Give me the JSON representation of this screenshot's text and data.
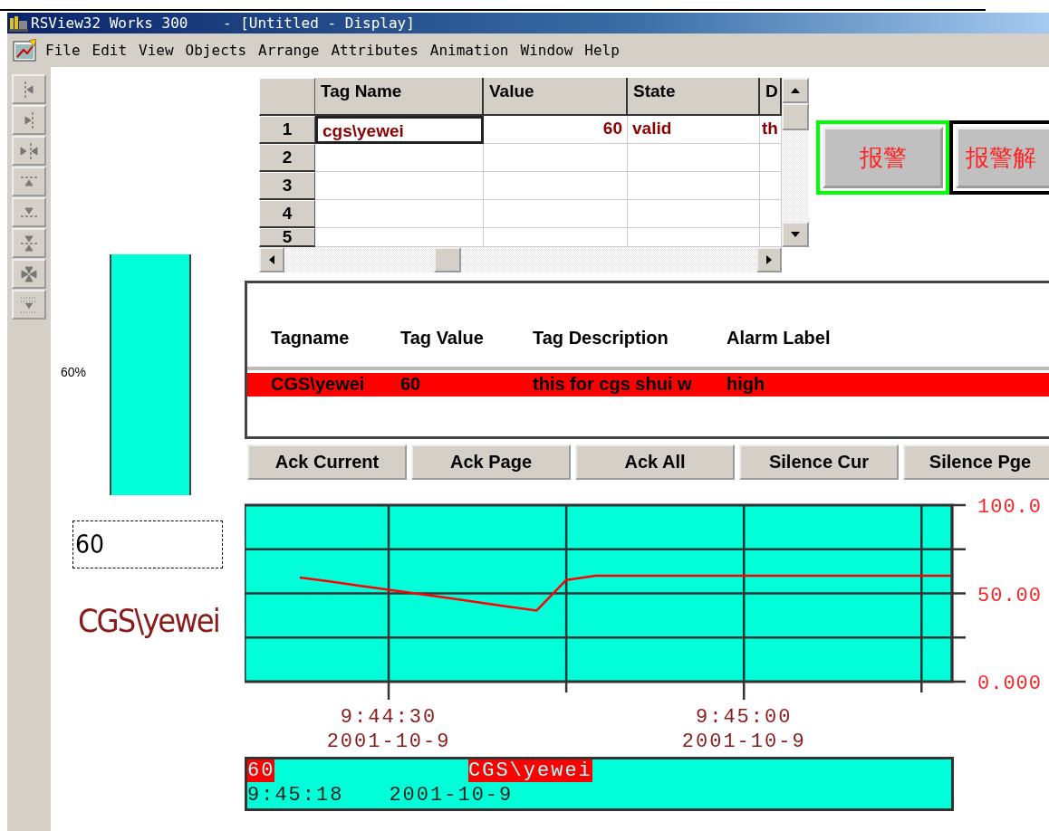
{
  "window": {
    "title": "RSView32 Works 300    - [Untitled - Display]"
  },
  "menu": [
    "File",
    "Edit",
    "View",
    "Objects",
    "Arrange",
    "Attributes",
    "Animation",
    "Window",
    "Help"
  ],
  "bar_graph": {
    "label": "60%"
  },
  "numeric_display": {
    "value": "60"
  },
  "tag_label": {
    "text": "CGS\\yewei"
  },
  "tag_table": {
    "columns": [
      "Tag Name",
      "Value",
      "State",
      "D"
    ],
    "rows": [
      {
        "number": "1",
        "selected": true,
        "cells": [
          "cgs\\yewei",
          "60",
          "valid",
          "th"
        ]
      },
      {
        "number": "2",
        "selected": false
      },
      {
        "number": "3",
        "selected": false
      },
      {
        "number": "4",
        "selected": false
      },
      {
        "number": "5",
        "selected": false
      }
    ]
  },
  "alarm_buttons": [
    {
      "label": "报警",
      "color": "#00ff00"
    },
    {
      "label": "报警解",
      "color": "#000000"
    }
  ],
  "alarm_summary": {
    "columns": [
      "Tagname",
      "Tag Value",
      "Tag Description",
      "Alarm Label"
    ],
    "rows": [
      {
        "cells": [
          "CGS\\yewei",
          "60",
          "this for cgs shui w",
          "high"
        ],
        "color": "#ff0000"
      }
    ]
  },
  "ack_buttons": [
    "Ack Current",
    "Ack Page",
    "Ack All",
    "Silence Cur",
    "Silence Pge"
  ],
  "trend": {
    "chart_data": {
      "type": "line",
      "grid": true,
      "ylim": [
        0,
        100
      ],
      "categories": [
        null,
        null,
        null,
        "9:44:30 2001-10-9",
        null,
        null,
        null,
        null,
        null,
        null,
        null,
        null,
        null,
        null,
        null,
        "9:45:00 2001-10-9",
        null,
        null,
        null,
        null,
        null,
        null,
        null
      ],
      "yticks": [
        {
          "value": 100,
          "label": "100.0"
        },
        {
          "value": 50,
          "label": "50.00"
        },
        {
          "value": 0,
          "label": "0.000"
        }
      ],
      "series": [
        {
          "color": "#ff0000",
          "values": [
            59,
            56.8,
            54.4,
            52.1,
            49.7,
            47.4,
            45,
            42.6,
            40.3,
            57.6,
            60,
            60,
            60,
            60,
            60,
            60,
            60,
            60,
            60,
            60,
            60,
            60,
            60
          ]
        }
      ]
    }
  },
  "status_panel": {
    "value": "60",
    "tag": "CGS\\yewei",
    "time": "9:45:18",
    "date": "2001-10-9"
  }
}
